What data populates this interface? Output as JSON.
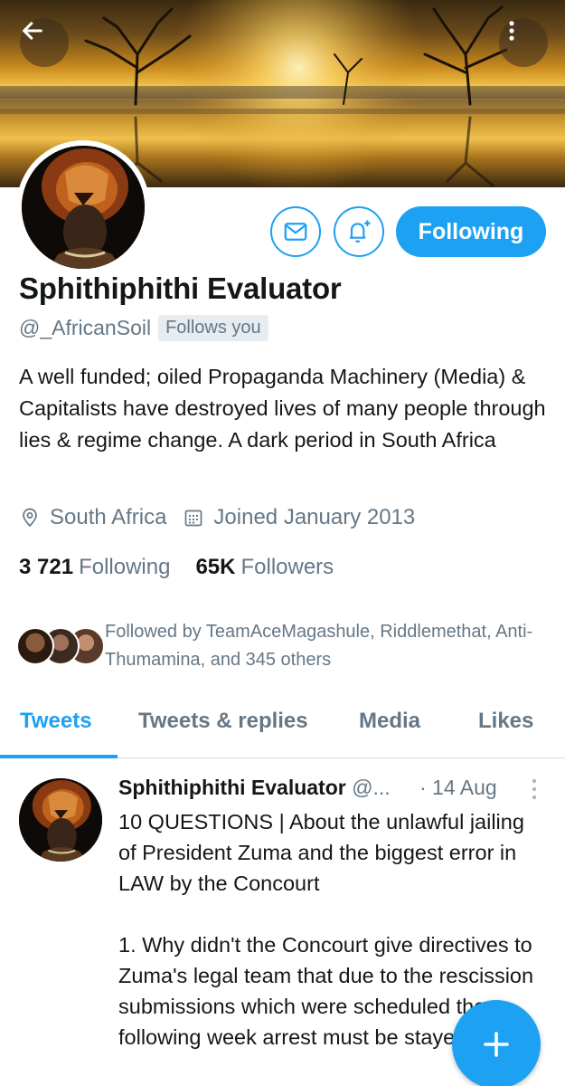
{
  "header": {
    "back_icon": "arrow-left-icon",
    "more_icon": "more-vertical-icon"
  },
  "profile": {
    "name": "Sphithiphithi Evaluator",
    "handle": "@_AfricanSoil",
    "follows_you": "Follows you",
    "bio": "A well funded; oiled Propaganda Machinery (Media) & Capitalists have destroyed lives of many people through lies & regime change. A dark period in South Africa",
    "location": "South Africa",
    "joined": "Joined January 2013",
    "following_count": "3 721",
    "following_label": "Following",
    "followers_count": "65K",
    "followers_label": "Followers",
    "followed_by": "Followed by TeamAceMagashule, Riddlemethat, Anti-Thumamina, and 345 others"
  },
  "actions": {
    "message_icon": "mail-icon",
    "notify_icon": "bell-plus-icon",
    "following_button": "Following"
  },
  "tabs": [
    {
      "label": "Tweets",
      "active": true
    },
    {
      "label": "Tweets & replies",
      "active": false
    },
    {
      "label": "Media",
      "active": false
    },
    {
      "label": "Likes",
      "active": false
    }
  ],
  "tweet": {
    "author": "Sphithiphithi Evaluator",
    "handle": "@...",
    "date": "· 14 Aug",
    "text": "10 QUESTIONS | About the unlawful jailing of President Zuma and the biggest error in LAW by the Concourt\n\n1. Why didn't the Concourt give directives to Zuma's legal team that due to the rescission submissions which were scheduled the following week arrest must be stayed?"
  },
  "fab": {
    "icon": "plus-icon"
  },
  "colors": {
    "accent": "#1da1f2",
    "text_primary": "#14171a",
    "text_secondary": "#657786",
    "divider": "#d8dee3"
  }
}
